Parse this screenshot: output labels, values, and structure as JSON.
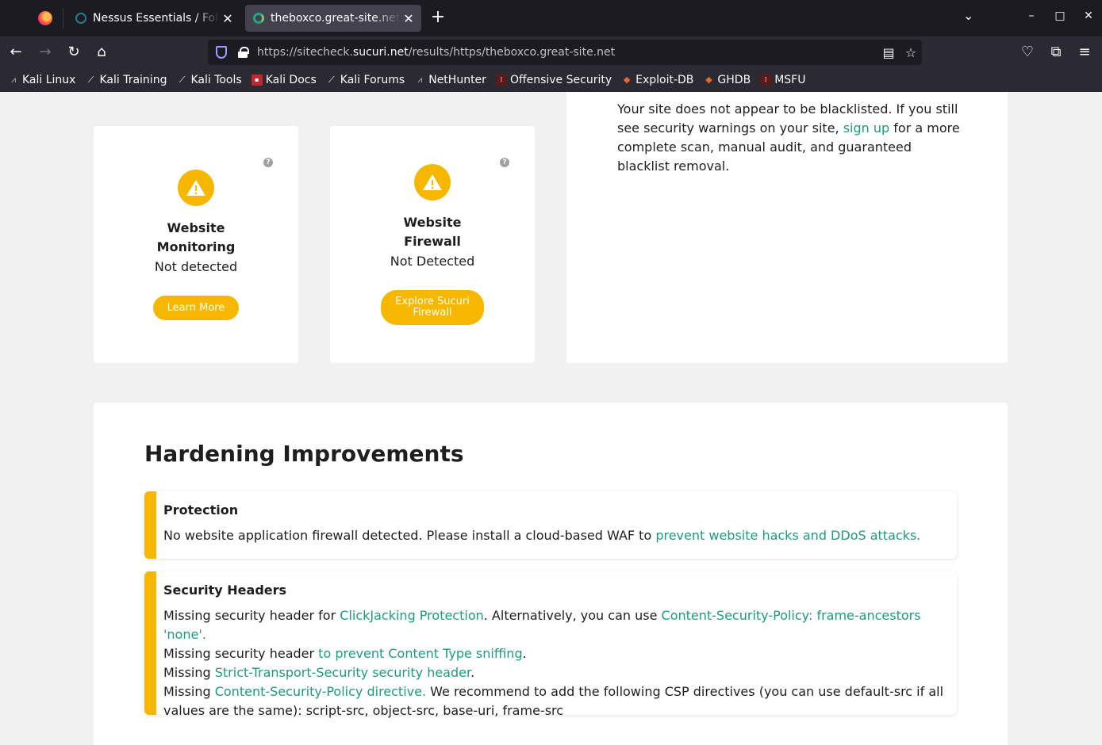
{
  "browser": {
    "tabs": [
      {
        "title": "Nessus Essentials / Folders",
        "close": "✕"
      },
      {
        "title": "theboxco.great-site.net - Sucuri SiteCheck",
        "close": "✕"
      }
    ],
    "new_tab": "+",
    "url": {
      "prefix": "https://sitecheck.",
      "host": "sucuri.net",
      "path": "/results/https/theboxco.great-site.net"
    },
    "bookmarks": [
      "Kali Linux",
      "Kali Training",
      "Kali Tools",
      "Kali Docs",
      "Kali Forums",
      "NetHunter",
      "Offensive Security",
      "Exploit-DB",
      "GHDB",
      "MSFU"
    ]
  },
  "monitoring": {
    "title": "Website Monitoring",
    "status": "Not detected",
    "button": "Learn More"
  },
  "firewall": {
    "title": "Website Firewall",
    "status": "Not Detected",
    "button": "Explore Sucuri Firewall"
  },
  "blacklist": {
    "text_1": "Your site does not appear to be blacklisted. If you still see security warnings on your site, ",
    "link": "sign up",
    "text_2": " for a more complete scan, manual audit, and guaranteed blacklist removal."
  },
  "hardening": {
    "title": "Hardening Improvements",
    "protection": {
      "title": "Protection",
      "text": "No website application firewall detected. Please install a cloud-based WAF to ",
      "link": "prevent website hacks and DDoS attacks."
    },
    "headers": {
      "title": "Security Headers",
      "line1_a": "Missing security header for ",
      "line1_link1": "ClickJacking Protection",
      "line1_b": ". Alternatively, you can use ",
      "line1_link2": "Content-Security-Policy: frame-ancestors 'none'.",
      "line2_a": "Missing security header ",
      "line2_link": "to prevent Content Type sniffing",
      "line2_b": ".",
      "line3_a": "Missing ",
      "line3_link": "Strict-Transport-Security security header",
      "line3_b": ".",
      "line4_a": "Missing ",
      "line4_link": "Content-Security-Policy directive.",
      "line4_b": " We recommend to add the following CSP directives (you can use default-src if all values are the same): script-src, object-src, base-uri, frame-src"
    }
  },
  "colors": {
    "accent": "#f5b700",
    "link": "#1c9c7e"
  },
  "icons": {
    "warning": "warning-icon",
    "help": "help-icon"
  }
}
